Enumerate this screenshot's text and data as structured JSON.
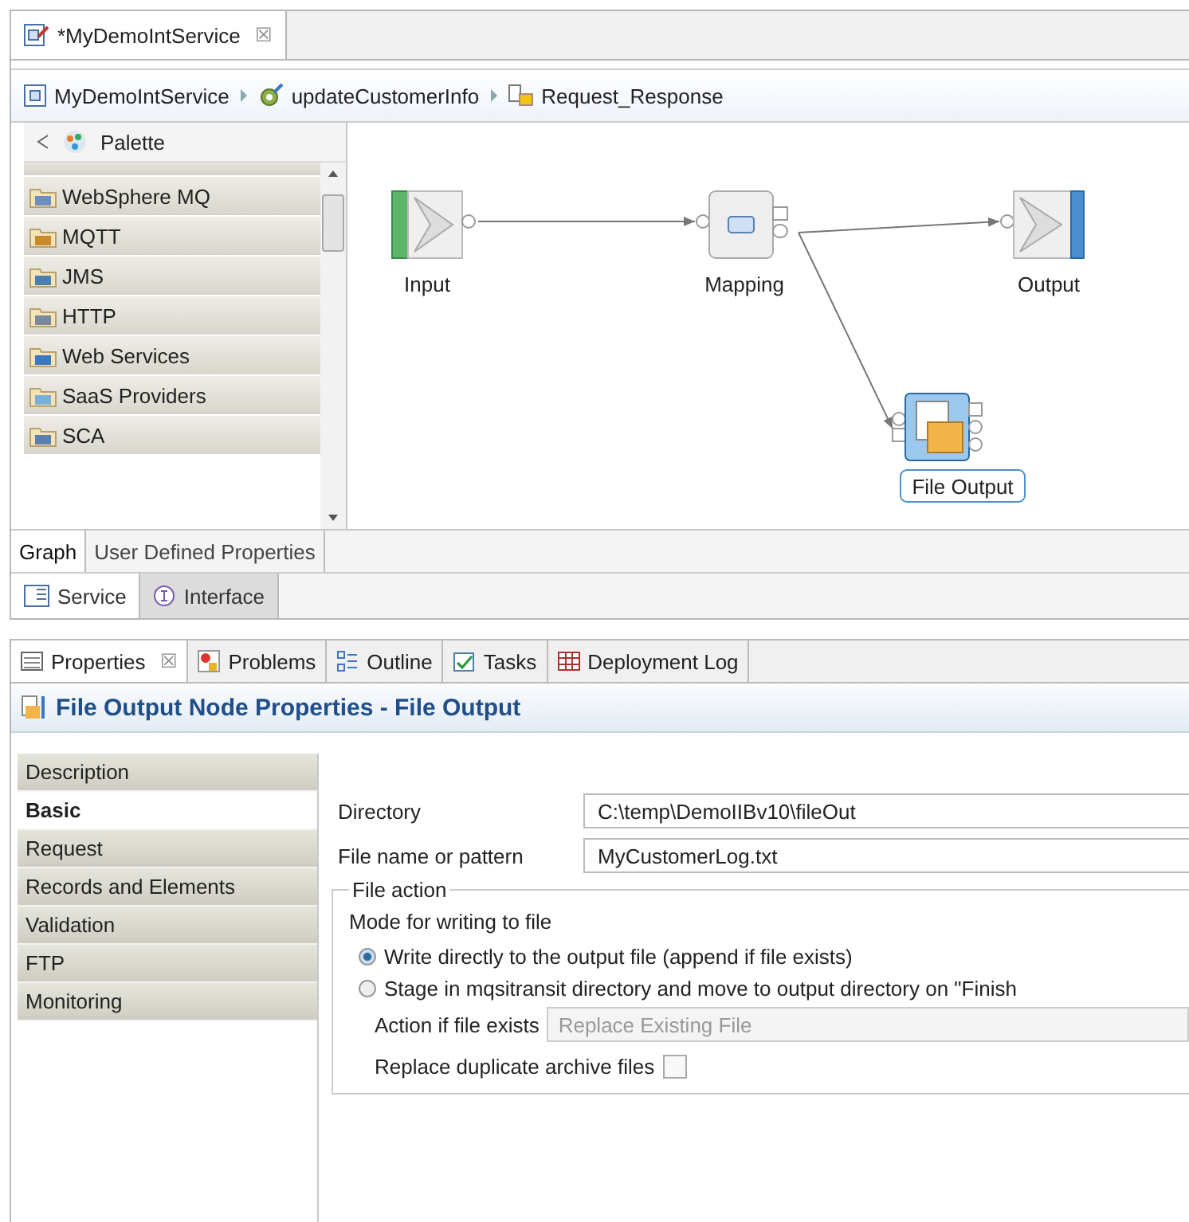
{
  "editor_tab": {
    "title": "*MyDemoIntService",
    "close": "☒"
  },
  "breadcrumb": [
    {
      "kind": "service",
      "label": "MyDemoIntService"
    },
    {
      "kind": "operation",
      "label": "updateCustomerInfo"
    },
    {
      "kind": "flow",
      "label": "Request_Response"
    }
  ],
  "palette": {
    "title": "Palette",
    "items": [
      {
        "kind": "mq",
        "label": "WebSphere MQ"
      },
      {
        "kind": "mqtt",
        "label": "MQTT"
      },
      {
        "kind": "jms",
        "label": "JMS"
      },
      {
        "kind": "http",
        "label": "HTTP"
      },
      {
        "kind": "web",
        "label": "Web Services"
      },
      {
        "kind": "saas",
        "label": "SaaS Providers"
      },
      {
        "kind": "sca",
        "label": "SCA"
      }
    ]
  },
  "diagram": {
    "nodes": [
      {
        "kind": "input",
        "label": "Input",
        "selected": false
      },
      {
        "kind": "mapping",
        "label": "Mapping",
        "selected": false
      },
      {
        "kind": "output",
        "label": "Output",
        "selected": false
      },
      {
        "kind": "file-output",
        "label": "File Output",
        "selected": true
      }
    ]
  },
  "graph_tabs": [
    {
      "label": "Graph",
      "selected": true
    },
    {
      "label": "User Defined Properties",
      "selected": false
    }
  ],
  "service_tabs": [
    {
      "kind": "service",
      "label": "Service",
      "selected": true
    },
    {
      "kind": "interface",
      "label": "Interface",
      "selected": false
    }
  ],
  "view_tabs": [
    {
      "kind": "properties",
      "label": "Properties",
      "close": "☒",
      "selected": true
    },
    {
      "kind": "problems",
      "label": "Problems",
      "selected": false
    },
    {
      "kind": "outline",
      "label": "Outline",
      "selected": false
    },
    {
      "kind": "tasks",
      "label": "Tasks",
      "selected": false
    },
    {
      "kind": "log",
      "label": "Deployment Log",
      "selected": false
    }
  ],
  "properties": {
    "title": "File Output Node Properties - File Output",
    "nav": [
      {
        "label": "Description",
        "selected": false
      },
      {
        "label": "Basic",
        "selected": true
      },
      {
        "label": "Request",
        "selected": false
      },
      {
        "label": "Records and Elements",
        "selected": false
      },
      {
        "label": "Validation",
        "selected": false
      },
      {
        "label": "FTP",
        "selected": false
      },
      {
        "label": "Monitoring",
        "selected": false
      }
    ],
    "fields": [
      {
        "label": "Directory",
        "value": "C:\\temp\\DemoIIBv10\\fileOut"
      },
      {
        "label": "File name or pattern",
        "value": "MyCustomerLog.txt"
      }
    ],
    "file_action": {
      "legend": "File action",
      "mode_label": "Mode for writing to file",
      "options": [
        {
          "label": "Write directly to the output file (append if file exists)",
          "selected": true
        },
        {
          "label": "Stage in mqsitransit directory and move to output directory on \"Finish",
          "selected": false
        }
      ],
      "action_label": "Action if file exists",
      "action_value": "Replace Existing File",
      "action_disabled": true,
      "replace_label": "Replace duplicate archive files",
      "replace_checked": false
    }
  }
}
